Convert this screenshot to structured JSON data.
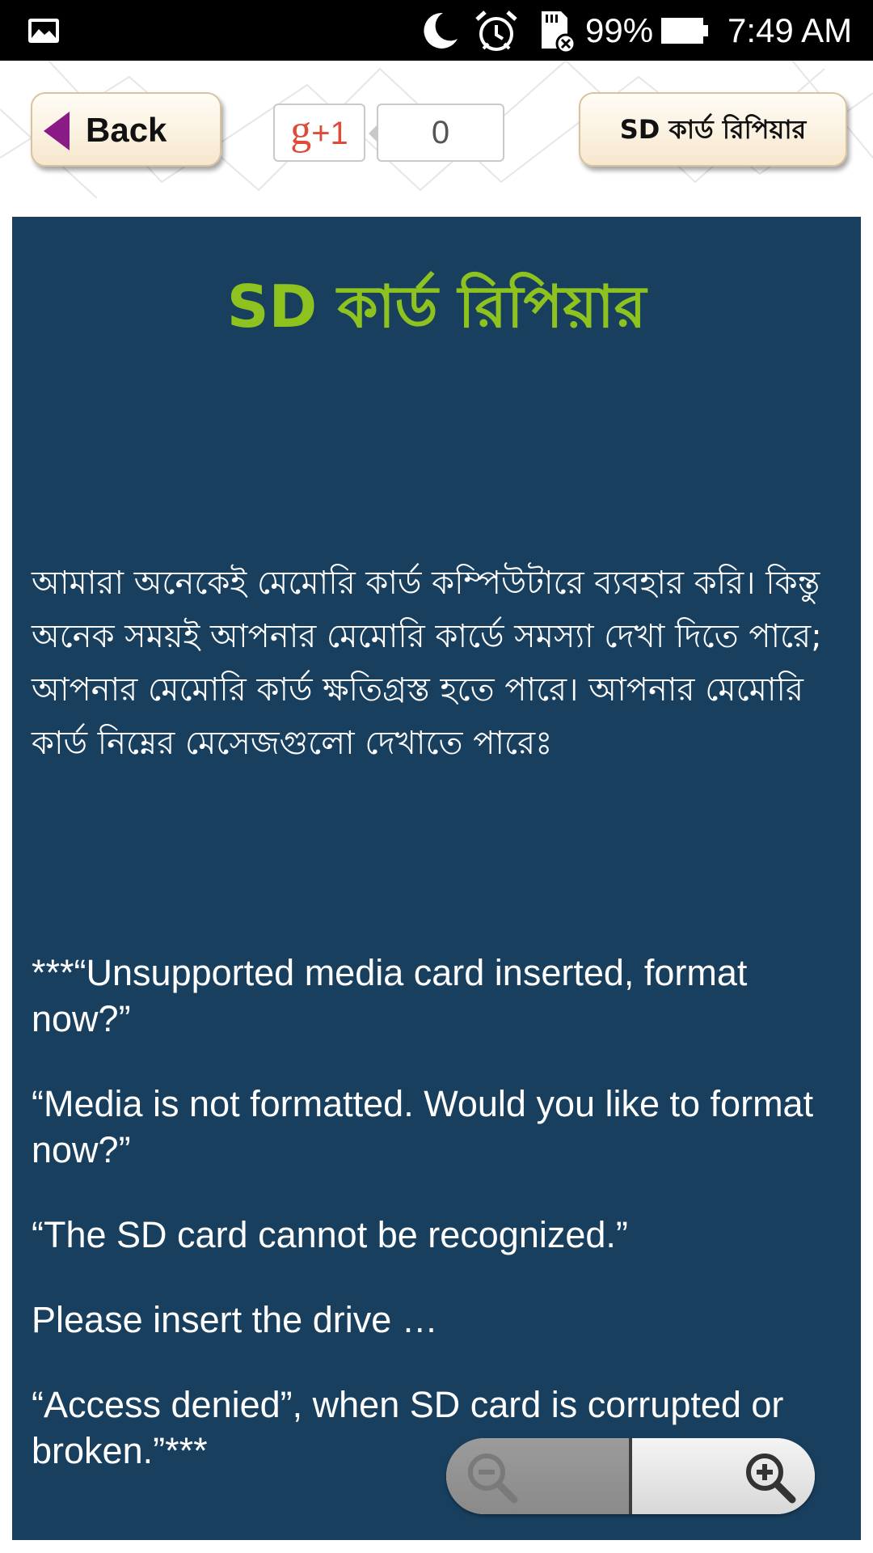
{
  "status_bar": {
    "battery_percent": "99%",
    "time": "7:49 AM",
    "icons": [
      "gallery-icon",
      "moon-icon",
      "alarm-icon",
      "sd-card-error-icon",
      "battery-icon"
    ]
  },
  "header": {
    "back_label": "Back",
    "gplus_g": "g",
    "gplus_plus_one": "+1",
    "gplus_count": "0",
    "title_button_label": "SD কার্ড রিপিয়ার"
  },
  "content": {
    "title": "SD কার্ড রিপিয়ার",
    "intro": "আমারা অনেকেই মেমোরি কার্ড কম্পিউটারে ব্যবহার করি। কিন্তু অনেক সময়ই আপনার মেমোরি কার্ডে সমস্যা দেখা দিতে পারে; আপনার মেমোরি কার্ড ক্ষতিগ্রস্ত হতে পারে। আপনার মেমোরি কার্ড নিম্নের মেসেজগুলো দেখাতে পারেঃ",
    "messages": [
      "***“Unsupported media card inserted, format now?”",
      "“Media is not formatted. Would you like to format now?”",
      "“The SD card cannot be recognized.”",
      "Please insert the drive …",
      "“Access denied”, when SD card is corrupted or broken.”***"
    ]
  },
  "zoom": {
    "out_icon": "zoom-out-icon",
    "in_icon": "zoom-in-icon"
  },
  "colors": {
    "panel_bg": "#193f5f",
    "title_green": "#8dc21f",
    "back_arrow": "#8a1b86",
    "gplus_red": "#dd4b39"
  }
}
